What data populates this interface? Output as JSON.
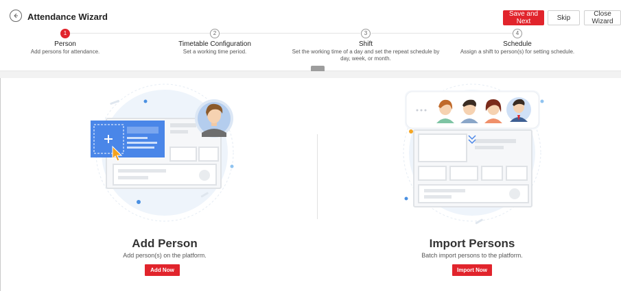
{
  "header": {
    "title": "Attendance Wizard",
    "save_next": "Save and Next",
    "skip": "Skip",
    "close": "Close Wizard"
  },
  "steps": [
    {
      "num": "1",
      "title": "Person",
      "desc": "Add persons for attendance.",
      "active": true
    },
    {
      "num": "2",
      "title": "Timetable Configuration",
      "desc": "Set a working time period.",
      "active": false
    },
    {
      "num": "3",
      "title": "Shift",
      "desc": "Set the working time of a day and set the repeat schedule by day, week, or month.",
      "active": false
    },
    {
      "num": "4",
      "title": "Schedule",
      "desc": "Assign a shift to person(s) for setting schedule.",
      "active": false
    }
  ],
  "panels": {
    "add": {
      "title": "Add Person",
      "desc": "Add person(s) on the platform.",
      "button": "Add Now"
    },
    "import": {
      "title": "Import Persons",
      "desc": "Batch import persons to the platform.",
      "button": "Import Now"
    }
  },
  "colors": {
    "accent": "#e1242c",
    "blue": "#4a86e8",
    "light_blue": "#eaf2fb"
  },
  "icons": [
    "back-arrow-icon",
    "plus-icon",
    "cursor-icon",
    "double-chevron-down-icon",
    "ellipsis-icon",
    "avatar"
  ]
}
